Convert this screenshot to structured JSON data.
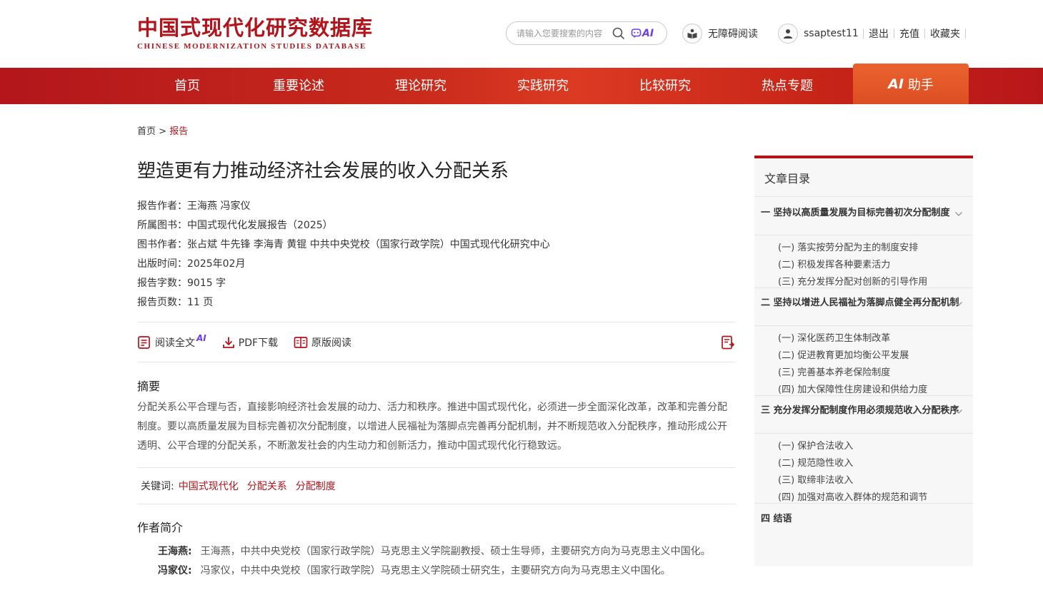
{
  "header": {
    "logo_cn": "中国式现代化研究数据库",
    "logo_en": "CHINESE MODERNIZATION STUDIES DATABASE",
    "search_placeholder": "请输入您要搜索的内容",
    "ai_label": "AI",
    "accessibility": "无障碍阅读",
    "username": "ssaptest11",
    "links": [
      "退出",
      "充值",
      "收藏夹"
    ]
  },
  "nav": {
    "items": [
      "首页",
      "重要论述",
      "理论研究",
      "实践研究",
      "比较研究",
      "热点专题"
    ],
    "ai_mark": "AI",
    "ai_label": "助手"
  },
  "breadcrumb": {
    "home": "首页",
    "sep": ">",
    "current": "报告"
  },
  "article": {
    "title": "塑造更有力推动经济社会发展的收入分配关系",
    "meta": [
      "报告作者：王海燕 冯家仪",
      "所属图书：中国式现代化发展报告（2025）",
      "图书作者：张占斌 牛先锋 李海青 黄锟 中共中央党校（国家行政学院）中国式现代化研究中心",
      "出版时间：2025年02月",
      "报告字数：9015 字",
      "报告页数：11 页"
    ],
    "actions": {
      "read": "阅读全文",
      "read_ai": "AI",
      "pdf": "PDF下载",
      "original": "原版阅读"
    },
    "abstract_heading": "摘要",
    "abstract": "分配关系公平合理与否，直接影响经济社会发展的动力、活力和秩序。推进中国式现代化，必须进一步全面深化改革，改革和完善分配制度。要以高质量发展为目标完善初次分配制度，以增进人民福祉为落脚点完善再分配机制，并不断规范收入分配秩序，推动形成公开透明、公平合理的分配关系，不断激发社会的内生动力和创新活力，推动中国式现代化行稳致远。",
    "keywords_label": "关键词:",
    "keywords": [
      "中国式现代化",
      "分配关系",
      "分配制度"
    ],
    "author_heading": "作者简介",
    "authors": [
      {
        "name": "王海燕:",
        "bio": "王海燕，中共中央党校（国家行政学院）马克思主义学院副教授、硕士生导师，主要研究方向为马克思主义中国化。"
      },
      {
        "name": "冯家仪:",
        "bio": "冯家仪，中共中央党校（国家行政学院）马克思主义学院硕士研究生，主要研究方向为马克思主义中国化。"
      }
    ]
  },
  "toc": {
    "title": "文章目录",
    "ch1": {
      "title": "一 坚持以高质量发展为目标完善初次分配制度",
      "subs": [
        "(一) 落实按劳分配为主的制度安排",
        "(二) 积极发挥各种要素活力",
        "(三) 充分发挥分配对创新的引导作用"
      ]
    },
    "ch2": {
      "title": "二 坚持以增进人民福祉为落脚点健全再分配机制",
      "subs": [
        "(一) 深化医药卫生体制改革",
        "(二) 促进教育更加均衡公平发展",
        "(三) 完善基本养老保险制度",
        "(四) 加大保障性住房建设和供给力度"
      ]
    },
    "ch3": {
      "title": "三 充分发挥分配制度作用必须规范收入分配秩序",
      "subs": [
        "(一) 保护合法收入",
        "(二) 规范隐性收入",
        "(三) 取缔非法收入",
        "(四) 加强对高收入群体的规范和调节"
      ]
    },
    "ch4": {
      "title": "四 结语"
    }
  },
  "colors": {
    "brand": "#b3141b",
    "ai_accent": "#6c3df0",
    "nav_ai": "#e25a28"
  }
}
